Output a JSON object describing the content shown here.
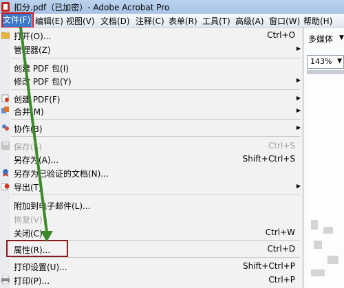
{
  "window": {
    "title": "扣分.pdf（已加密）- Adobe Acrobat Pro"
  },
  "menubar": {
    "items": [
      {
        "label": "文件(F)"
      },
      {
        "label": "编辑(E)"
      },
      {
        "label": "视图(V)"
      },
      {
        "label": "文档(D)"
      },
      {
        "label": "注释(C)"
      },
      {
        "label": "表单(R)"
      },
      {
        "label": "工具(T)"
      },
      {
        "label": "高级(A)"
      },
      {
        "label": "窗口(W)"
      },
      {
        "label": "帮助(H)"
      }
    ]
  },
  "toolbar": {
    "multimedia_label": "多媒体",
    "zoom_value": "143%"
  },
  "file_menu": {
    "items": [
      {
        "label": "打开(O)...",
        "shortcut": "Ctrl+O",
        "icon": "folder-icon"
      },
      {
        "label": "管理器(Z)",
        "submenu": true
      },
      {
        "label": "创建 PDF 包(I)"
      },
      {
        "label": "修改 PDF 包(Y)",
        "submenu": true
      },
      {
        "label": "创建 PDF(F)",
        "submenu": true,
        "icon": "create-pdf-icon"
      },
      {
        "label": "合并(M)",
        "submenu": true,
        "icon": "combine-icon"
      },
      {
        "label": "协作(B)",
        "submenu": true,
        "icon": "collaborate-icon"
      },
      {
        "label": "保存(S)",
        "shortcut": "Ctrl+S",
        "disabled": true,
        "icon": "save-icon"
      },
      {
        "label": "另存为(A)...",
        "shortcut": "Shift+Ctrl+S"
      },
      {
        "label": "另存为已验证的文档(N)...",
        "icon": "certified-icon"
      },
      {
        "label": "导出(T)",
        "submenu": true,
        "icon": "export-icon"
      },
      {
        "label": "附加到电子邮件(L)..."
      },
      {
        "label": "恢复(V)",
        "disabled": true
      },
      {
        "label": "关闭(C)",
        "shortcut": "Ctrl+W"
      },
      {
        "label": "属性(R)...",
        "shortcut": "Ctrl+D"
      },
      {
        "label": "打印设置(U)...",
        "shortcut": "Shift+Ctrl+P"
      },
      {
        "label": "打印(P)...",
        "shortcut": "Ctrl+P",
        "icon": "printer-icon"
      }
    ]
  },
  "colors": {
    "highlight_red": "#c8141e",
    "arrow_green": "#3a8a2a",
    "menu_active": "#3d78c8"
  }
}
